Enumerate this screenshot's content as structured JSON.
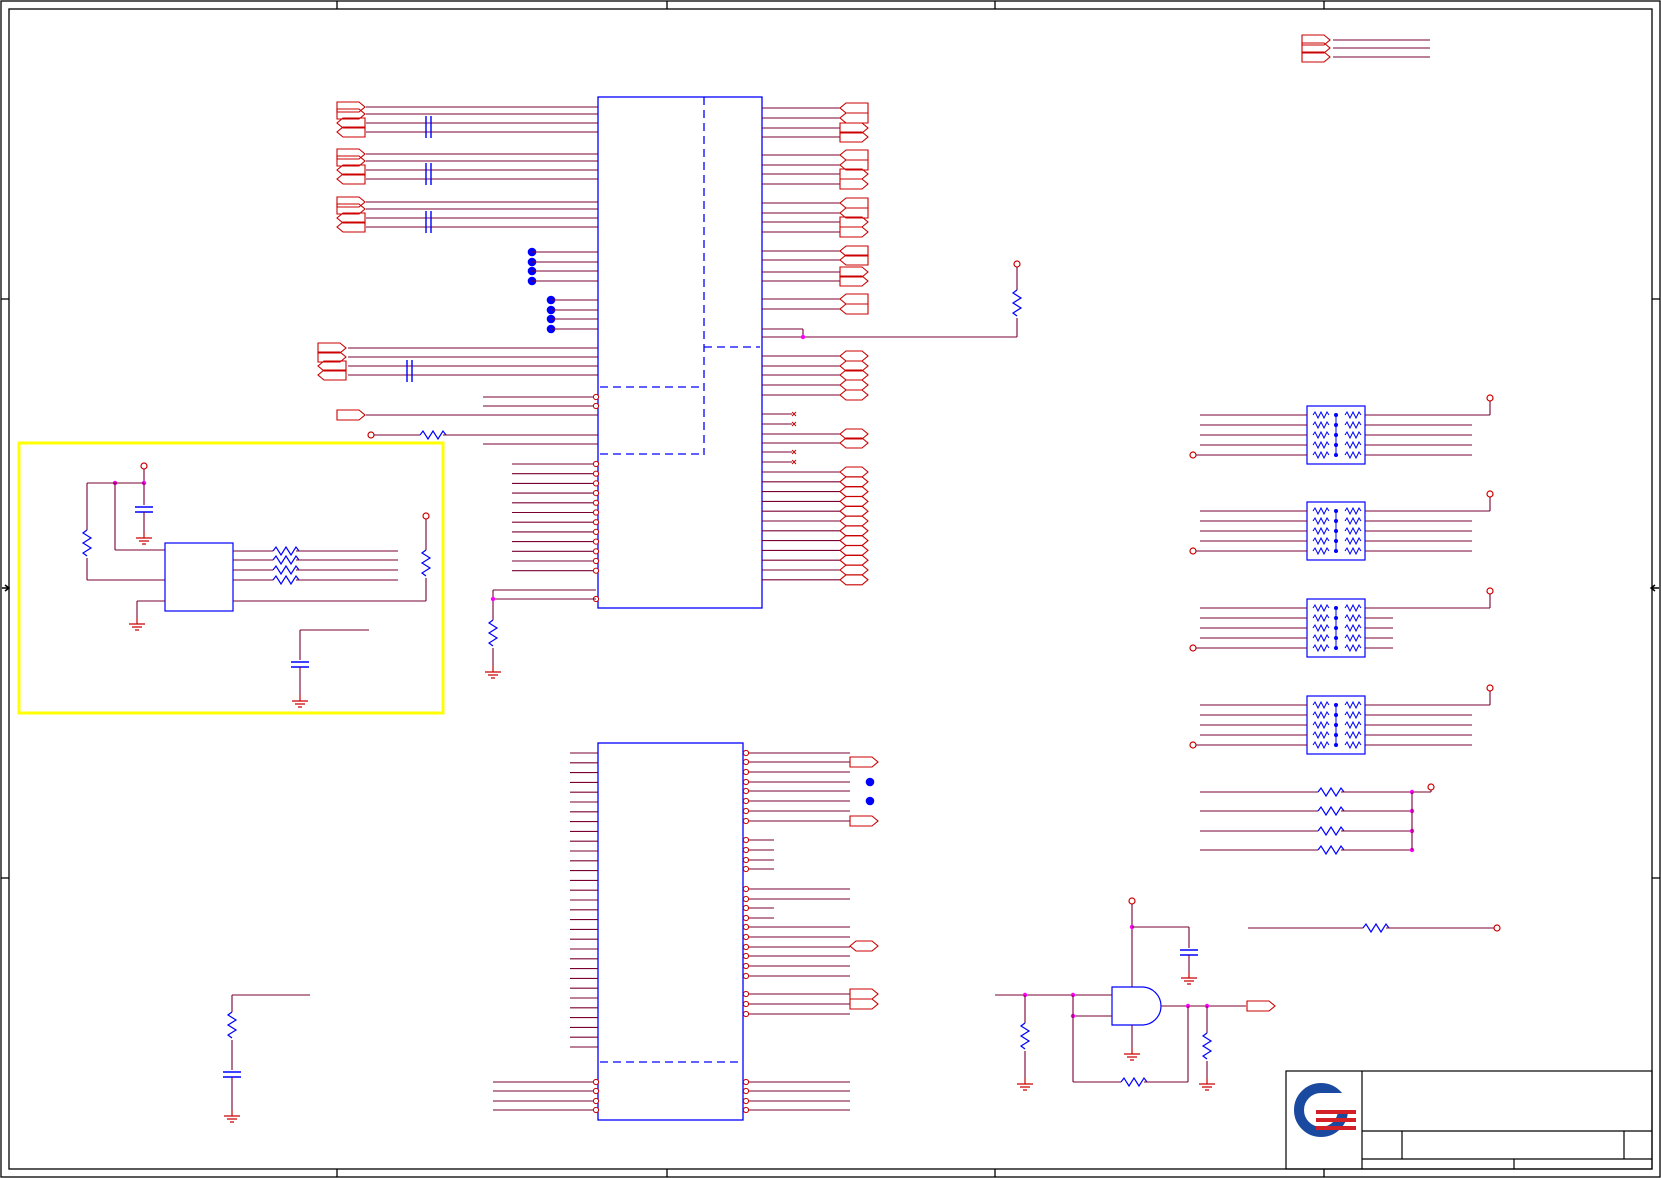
{
  "schematic": {
    "sheet": "",
    "logo": "company-logo",
    "colors": {
      "wire": "#cc0000",
      "bus": "#7a0033",
      "part": "#0000ff",
      "junction": "#ff00ff",
      "highlight": "#ffff00",
      "border": "#000000",
      "logo_blue": "#1a4aa0",
      "logo_red": "#d31f26"
    },
    "callout": {
      "highlighted": true,
      "color": "#ffff00"
    },
    "title_block": {
      "present": true,
      "fields": []
    }
  }
}
